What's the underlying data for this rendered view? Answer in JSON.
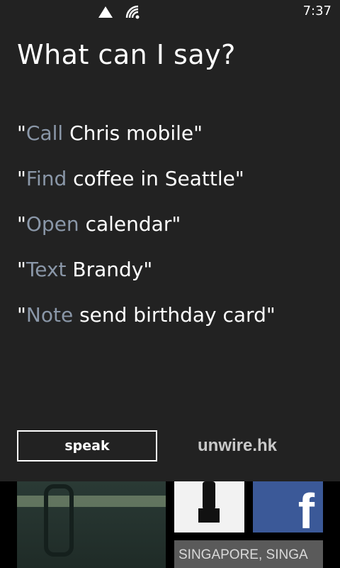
{
  "status_bar": {
    "time": "7:37",
    "signal_icon": "signal-triangle-icon",
    "wifi_icon": "wifi-icon"
  },
  "title": "What can I say?",
  "commands": [
    {
      "verb": "Call",
      "rest": " Chris mobile\""
    },
    {
      "verb": "Find",
      "rest": " coffee in Seattle\""
    },
    {
      "verb": "Open",
      "rest": " calendar\""
    },
    {
      "verb": "Text",
      "rest": " Brandy\""
    },
    {
      "verb": "Note",
      "rest": " send birthday card\""
    }
  ],
  "quote_open": "\"",
  "speak_label": "speak",
  "watermark": "unwire.hk",
  "tiles": {
    "facebook_glyph": "f",
    "news_text": "SINGAPORE, SINGA"
  },
  "colors": {
    "panel": "#222222",
    "verb": "#8a97a8",
    "facebook": "#3b5998"
  }
}
